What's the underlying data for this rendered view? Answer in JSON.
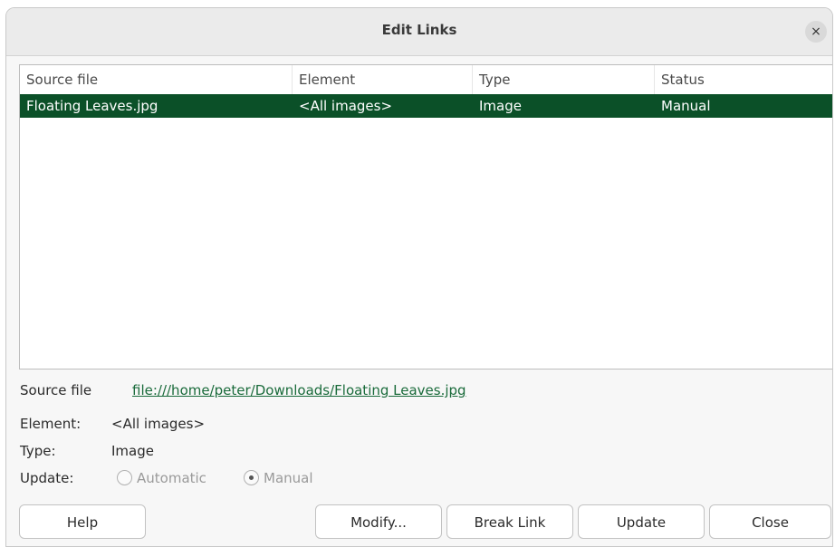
{
  "window": {
    "title": "Edit Links",
    "close_glyph": "×"
  },
  "table": {
    "columns": [
      "Source file",
      "Element",
      "Type",
      "Status"
    ],
    "rows": [
      {
        "source_file": "Floating Leaves.jpg",
        "element": "<All images>",
        "type": "Image",
        "status": "Manual",
        "selected": true
      }
    ]
  },
  "details": {
    "source_file_label": "Source file",
    "source_file_value": "file:///home/peter/Downloads/Floating Leaves.jpg",
    "element_label": "Element:",
    "element_value": "<All images>",
    "type_label": "Type:",
    "type_value": "Image",
    "update_label": "Update:",
    "update_options": [
      {
        "label": "Automatic",
        "selected": false,
        "enabled": false
      },
      {
        "label": "Manual",
        "selected": true,
        "enabled": false
      }
    ]
  },
  "buttons": {
    "help": "Help",
    "modify": "Modify...",
    "break_link": "Break Link",
    "update": "Update",
    "close": "Close"
  },
  "colors": {
    "selection": "#0b5028",
    "link": "#1a6b3b"
  }
}
